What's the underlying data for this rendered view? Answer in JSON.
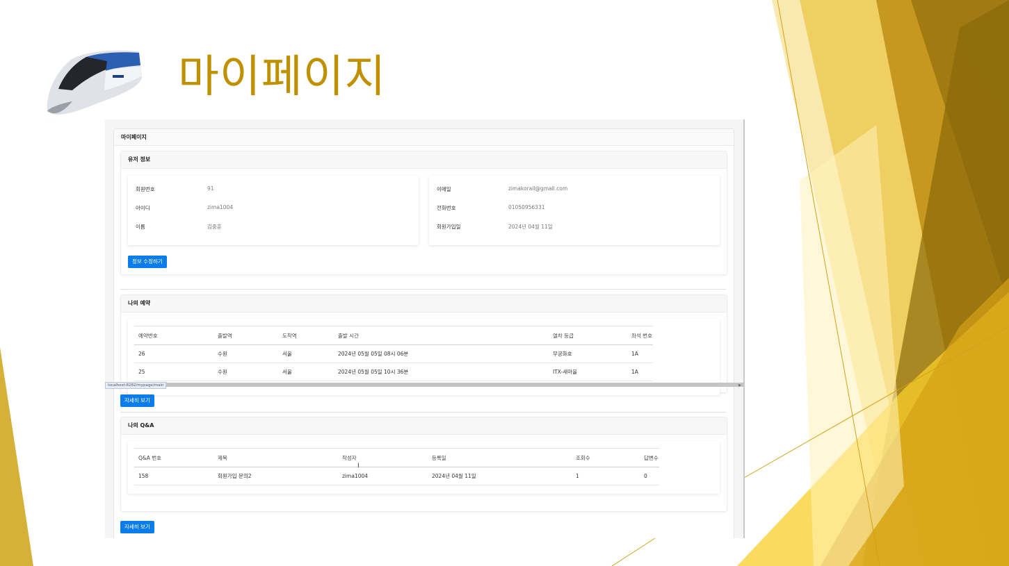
{
  "slide": {
    "title": "마이페이지"
  },
  "colors": {
    "accent_gold": "#bf9000",
    "button_blue": "#0b7dea"
  },
  "page": {
    "header": "마이페이지",
    "status_url": "localhost:8282/mypage/main"
  },
  "user_info": {
    "header": "유저 정보",
    "left": [
      {
        "label": "회원번호",
        "value": "91"
      },
      {
        "label": "아이디",
        "value": "zima1004"
      },
      {
        "label": "이름",
        "value": "김중훈"
      }
    ],
    "right": [
      {
        "label": "이메일",
        "value": "zimakorail@gmail.com"
      },
      {
        "label": "전화번호",
        "value": "01050956331"
      },
      {
        "label": "회원가입일",
        "value": "2024년 04월 11일"
      }
    ],
    "edit_button": "정보 수정하기"
  },
  "reservations": {
    "header": "나의 예약",
    "columns": [
      "예약번호",
      "출발역",
      "도착역",
      "출발 시간",
      "열차 등급",
      "좌석 번호"
    ],
    "rows": [
      [
        "26",
        "수원",
        "서울",
        "2024년 05월 05일 08시 06분",
        "무궁화호",
        "1A"
      ],
      [
        "25",
        "수원",
        "서울",
        "2024년 05월 05일 10시 36분",
        "ITX-새마을",
        "1A"
      ]
    ],
    "detail_button": "자세히 보기"
  },
  "qna": {
    "header": "나의 Q&A",
    "columns": [
      "Q&A 번호",
      "제목",
      "작성자",
      "등록일",
      "조회수",
      "답변수"
    ],
    "rows": [
      [
        "158",
        "회원가입 문의2",
        "zima1004",
        "2024년 04월 11일",
        "1",
        "0"
      ]
    ],
    "detail_button": "자세히 보기"
  }
}
